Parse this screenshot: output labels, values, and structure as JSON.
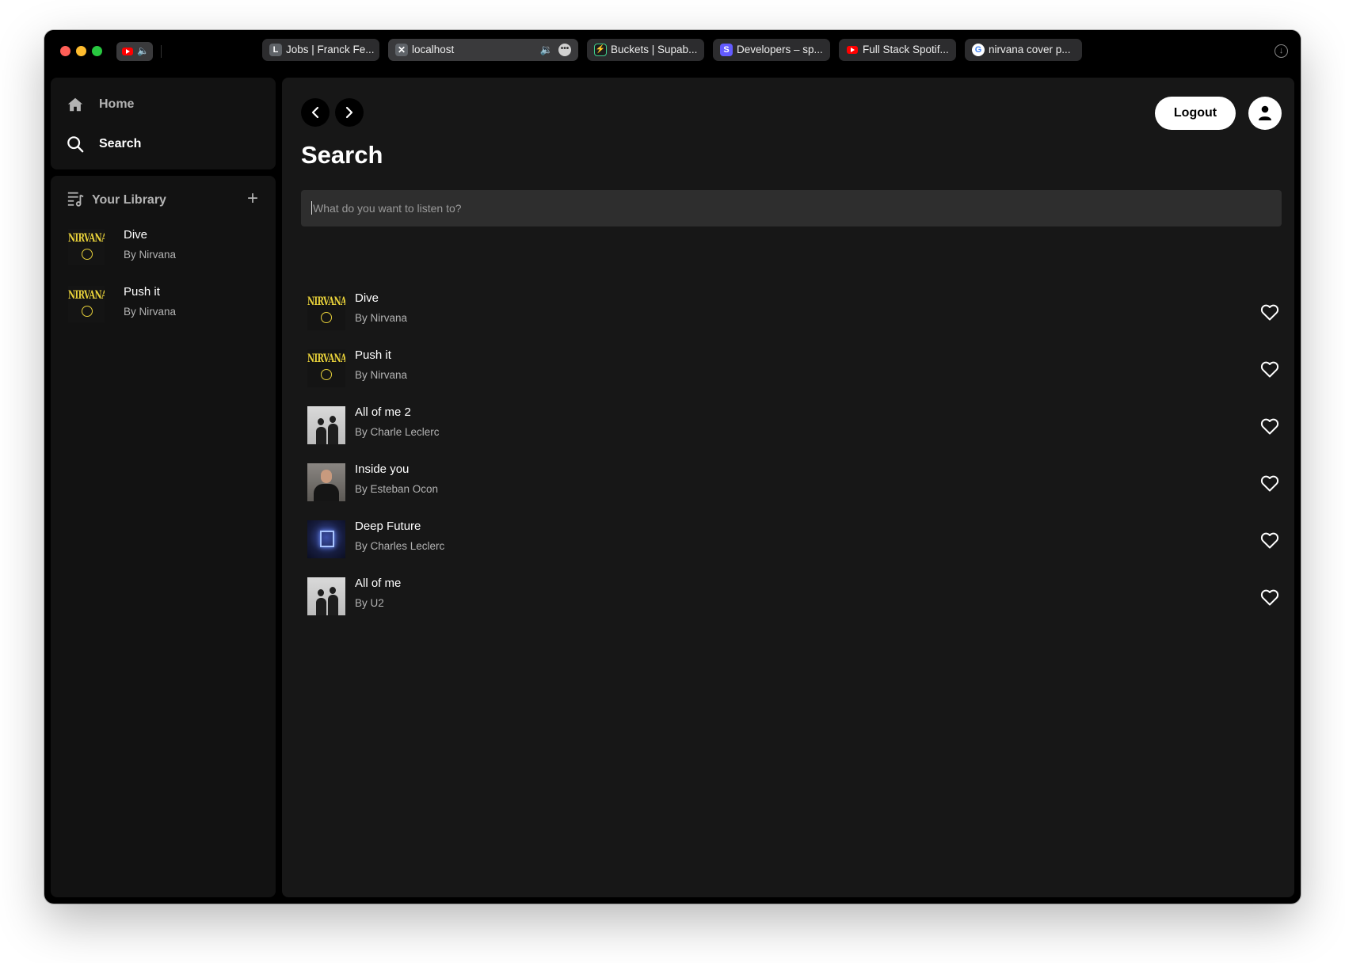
{
  "browser": {
    "tabs": [
      {
        "label": "Jobs | Franck Fe...",
        "favicon": "L",
        "favicon_color": "#5f6368",
        "active": false
      },
      {
        "label": "localhost",
        "favicon": "x-square-icon",
        "favicon_color": "#5f6368",
        "active": true
      },
      {
        "label": "Buckets | Supab...",
        "favicon": "supabase-icon",
        "favicon_color": "#3ecf8e",
        "active": false
      },
      {
        "label": "Developers – sp...",
        "favicon": "S",
        "favicon_color": "#635bff",
        "active": false
      },
      {
        "label": "Full Stack Spotif...",
        "favicon": "youtube-icon",
        "favicon_color": "#ff0000",
        "active": false
      },
      {
        "label": "nirvana cover p...",
        "favicon": "google-icon",
        "favicon_color": "#4285f4",
        "active": false
      }
    ]
  },
  "sidebar": {
    "nav": [
      {
        "label": "Home",
        "icon": "home-icon"
      },
      {
        "label": "Search",
        "icon": "search-icon"
      }
    ],
    "library": {
      "title": "Your Library",
      "add_icon": "plus-icon",
      "items": [
        {
          "title": "Dive",
          "artist": "By Nirvana",
          "cover": "nirvana"
        },
        {
          "title": "Push it",
          "artist": "By Nirvana",
          "cover": "nirvana"
        }
      ]
    }
  },
  "header": {
    "logout_label": "Logout",
    "user_icon": "user-icon"
  },
  "main": {
    "title": "Search",
    "search_placeholder": "What do you want to listen to?",
    "songs": [
      {
        "title": "Dive",
        "artist": "By Nirvana",
        "cover": "nirvana"
      },
      {
        "title": "Push it",
        "artist": "By Nirvana",
        "cover": "nirvana"
      },
      {
        "title": "All of me 2",
        "artist": "By Charle Leclerc",
        "cover": "duo"
      },
      {
        "title": "Inside you",
        "artist": "By Esteban Ocon",
        "cover": "portrait"
      },
      {
        "title": "Deep Future",
        "artist": "By Charles Leclerc",
        "cover": "future"
      },
      {
        "title": "All of me",
        "artist": "By U2",
        "cover": "duo"
      }
    ]
  },
  "colors": {
    "background": "#000000",
    "panel": "#121212",
    "main_panel": "#171717",
    "text_primary": "#ffffff",
    "text_secondary": "#b3b3b3",
    "nirvana_yellow": "#e8d13a"
  }
}
